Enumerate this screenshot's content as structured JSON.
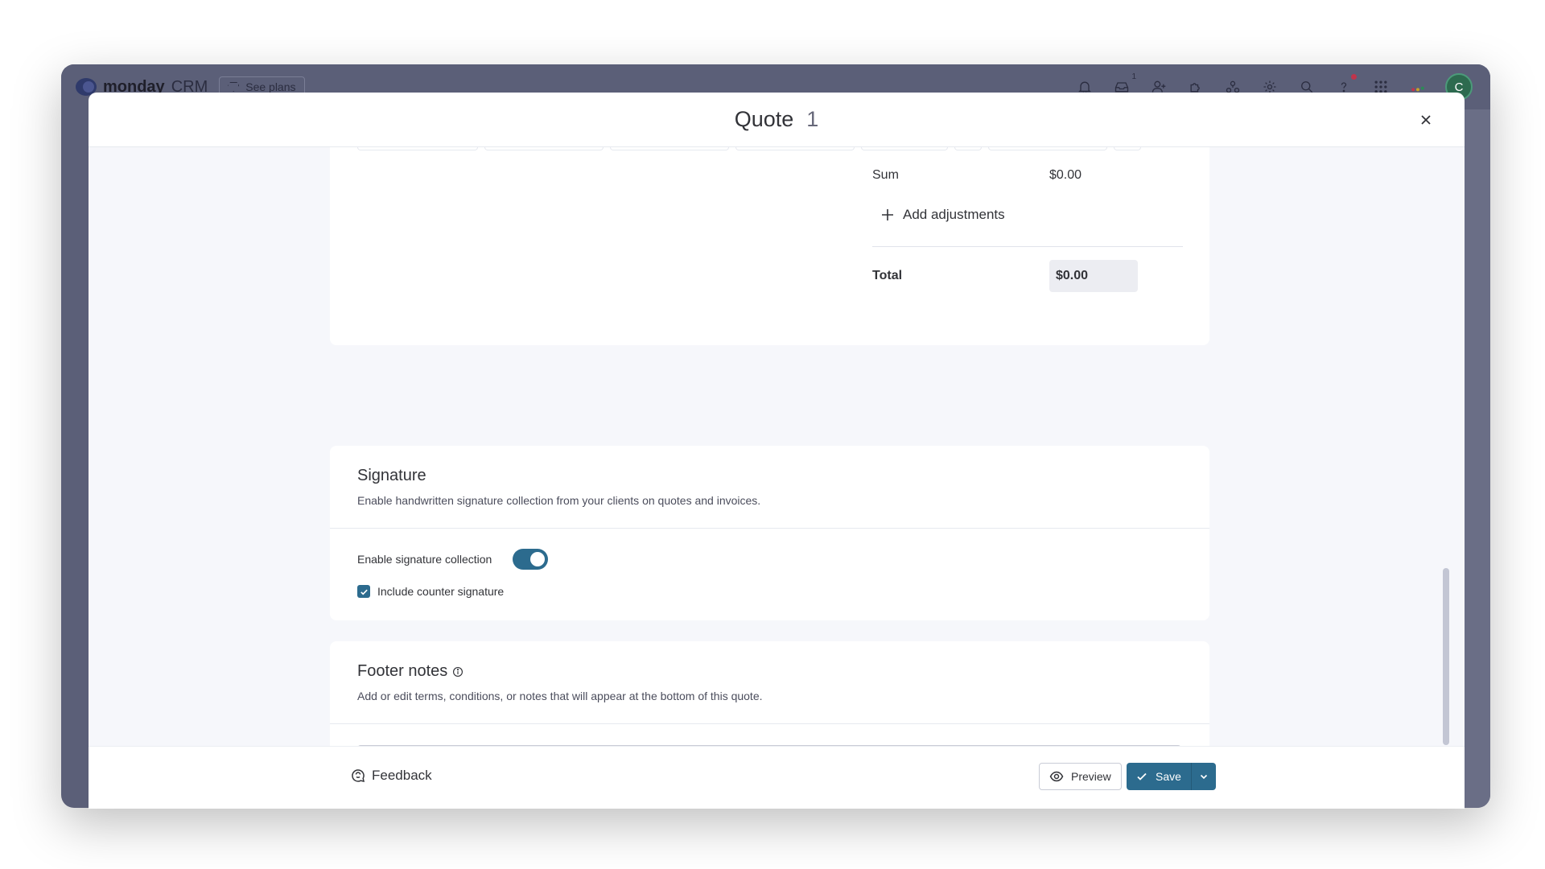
{
  "app": {
    "brand_bold": "monday",
    "brand_light": "CRM",
    "see_plans": "See plans",
    "inbox_count": "1",
    "avatar_initial": "C"
  },
  "modal": {
    "title": "Quote",
    "number": "1",
    "close_icon": "close-icon"
  },
  "totals": {
    "sum_label": "Sum",
    "sum_value": "$0.00",
    "add_adjustments": "Add adjustments",
    "total_label": "Total",
    "total_value": "$0.00"
  },
  "signature": {
    "title": "Signature",
    "description": "Enable handwritten signature collection from your clients on quotes and invoices.",
    "toggle_label": "Enable signature collection",
    "toggle_on": true,
    "counter_label": "Include counter signature",
    "counter_checked": true
  },
  "footer_notes": {
    "title": "Footer notes",
    "description": "Add or edit terms, conditions, or notes that will appear at the bottom of this quote.",
    "value": ""
  },
  "footer": {
    "feedback": "Feedback",
    "preview": "Preview",
    "save": "Save"
  },
  "colors": {
    "primary": "#2c6b8e",
    "backdrop": "#5b5f78",
    "surface": "#f6f7fb"
  }
}
